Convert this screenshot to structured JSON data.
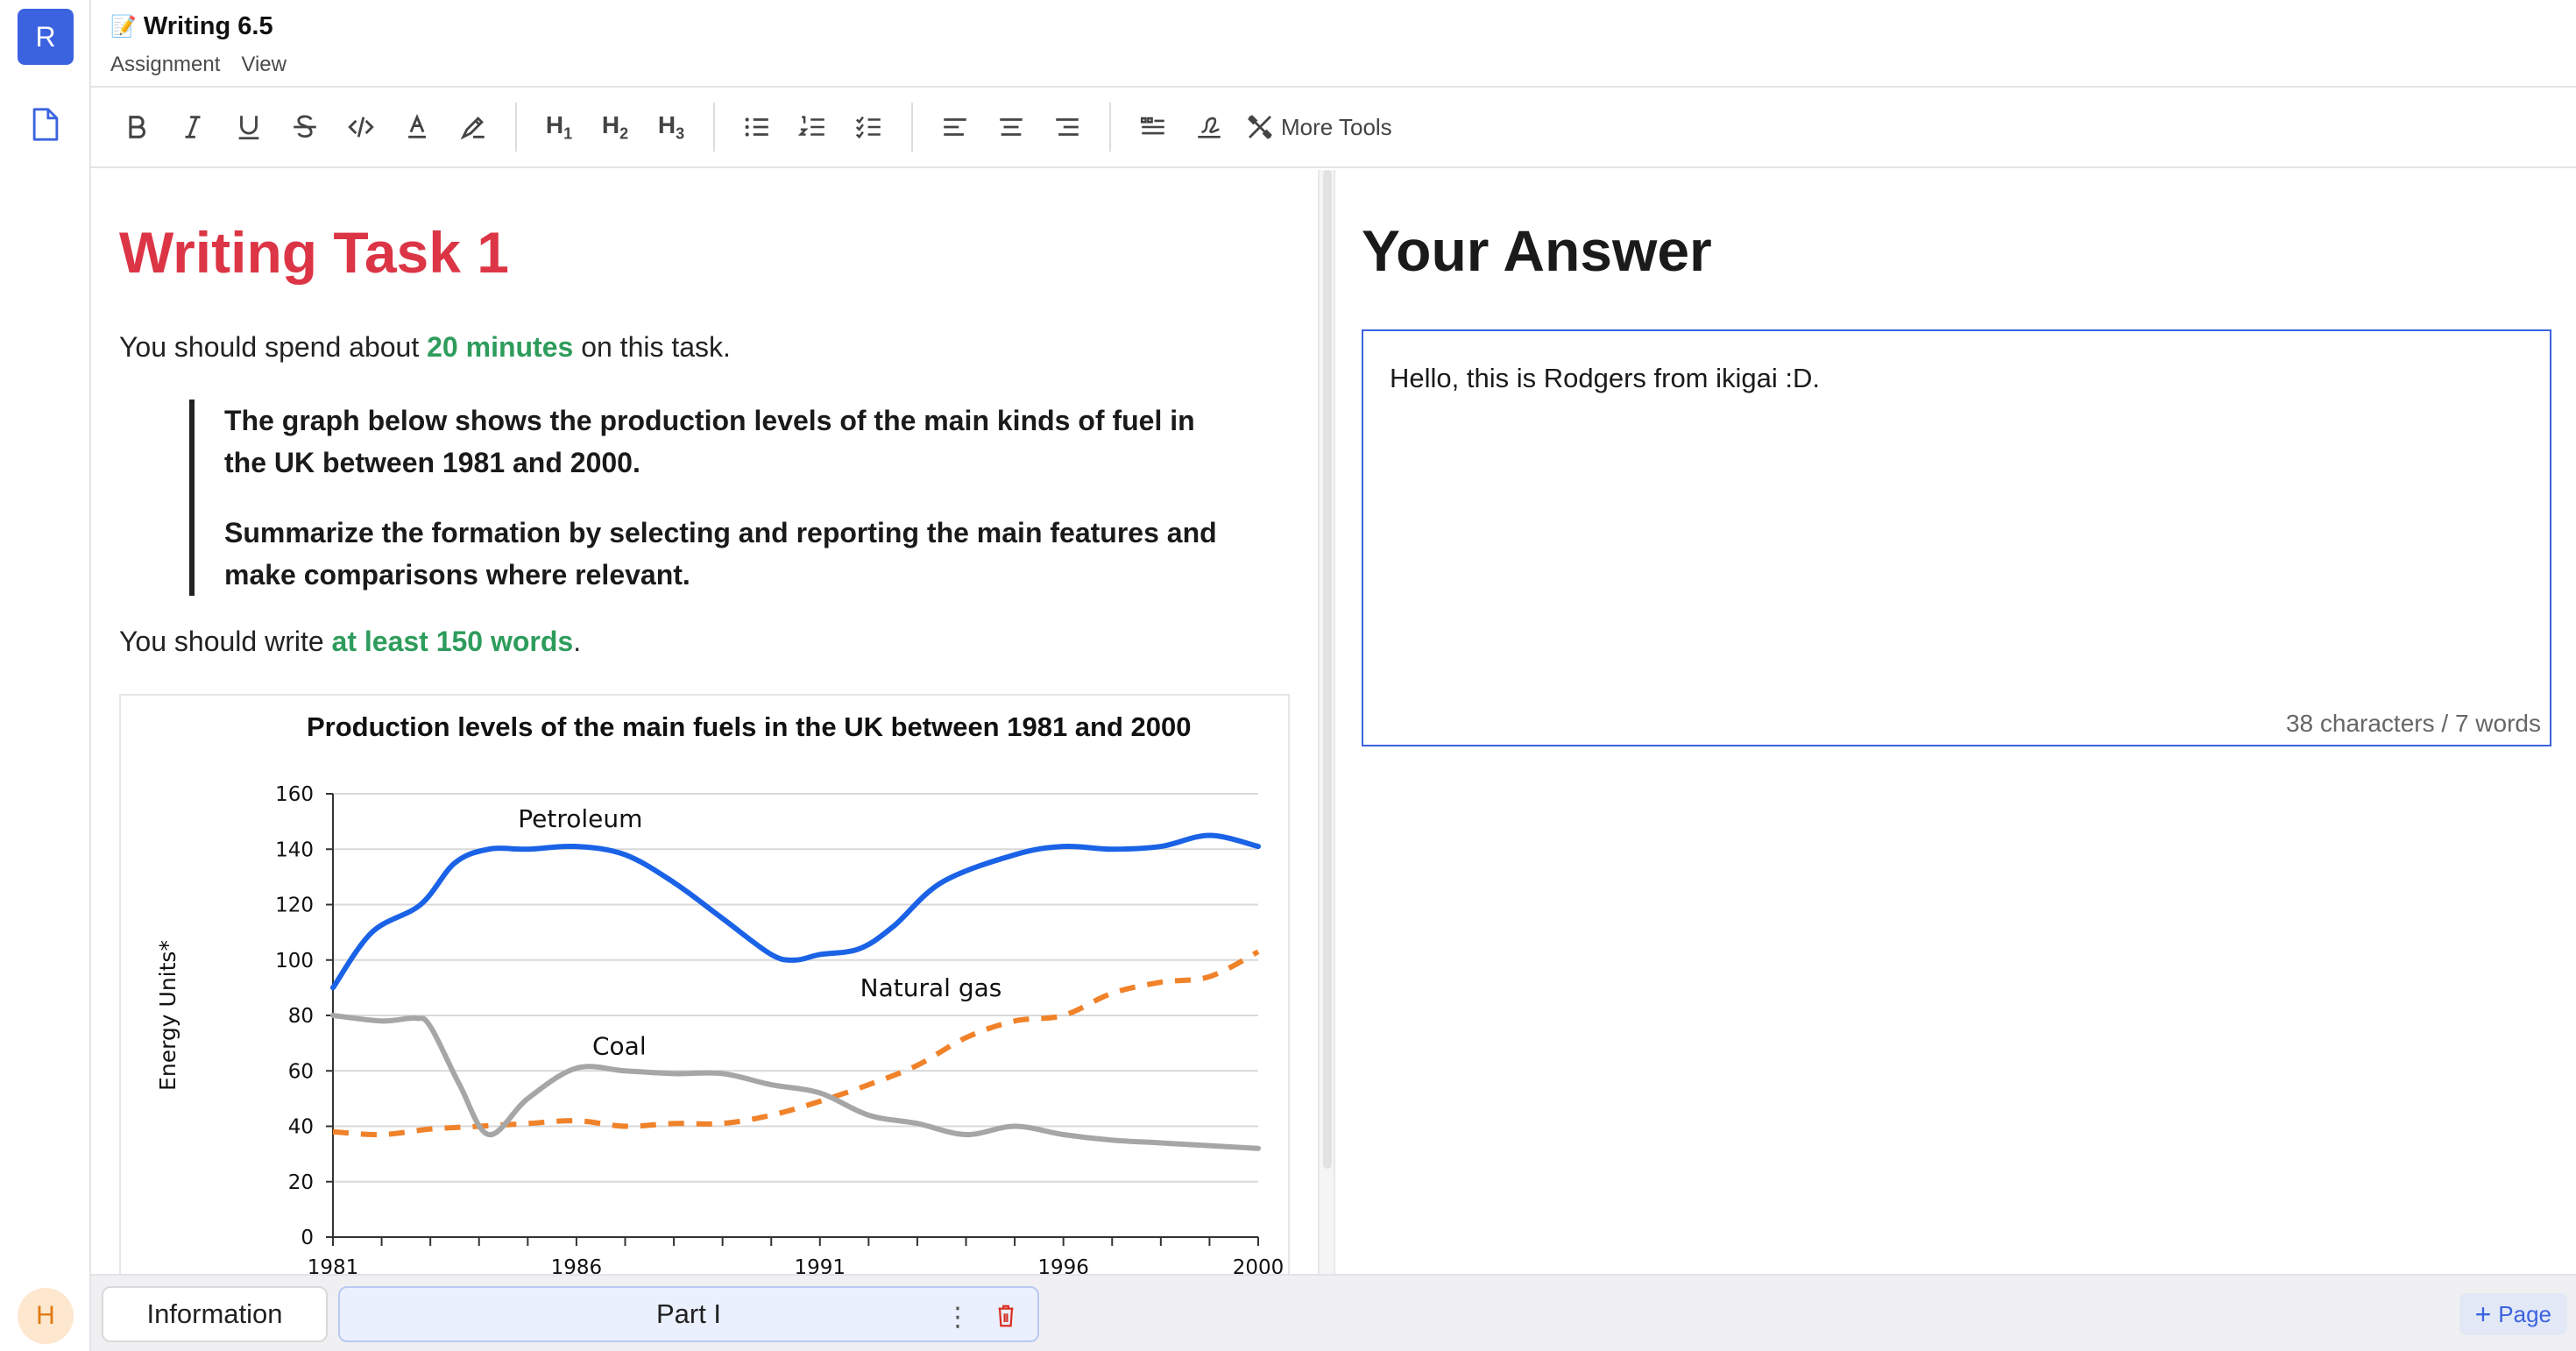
{
  "app": {
    "logo_letter": "R",
    "user_initial": "H"
  },
  "header": {
    "title": "Writing 6.5",
    "menus": [
      "Assignment",
      "View"
    ]
  },
  "toolbar": {
    "headings": [
      {
        "h": "H",
        "n": "1"
      },
      {
        "h": "H",
        "n": "2"
      },
      {
        "h": "H",
        "n": "3"
      }
    ],
    "more_tools_label": "More Tools"
  },
  "task": {
    "title": "Writing Task 1",
    "time_pre": "You should spend about ",
    "time_value": "20 minutes",
    "time_post": " on this task.",
    "prompt_1": "The graph below shows the production levels of the main kinds of fuel in the UK between 1981 and 2000.",
    "prompt_2": "Summarize the formation by selecting and reporting the main features and make comparisons where relevant.",
    "words_pre": "You should write ",
    "words_value": "at least 150 words",
    "words_post": "."
  },
  "answer": {
    "title": "Your Answer",
    "text": "Hello, this is Rodgers from ikigai :D.",
    "count": "38 characters / 7 words"
  },
  "bottom": {
    "tabs": [
      "Information",
      "Part I"
    ],
    "add_page_label": "Page"
  },
  "colors": {
    "accent": "#3b63e0",
    "task_title": "#dc3545",
    "highlight": "#2e9c5c",
    "petroleum": "#1a62e6",
    "natural_gas": "#f0822a",
    "coal": "#a6a6a6"
  },
  "chart_data": {
    "type": "line",
    "title": "Production levels of the main fuels in the UK between 1981 and 2000",
    "xlabel": "",
    "ylabel": "Energy Units*",
    "xlim": [
      1981,
      2000
    ],
    "ylim": [
      0,
      160
    ],
    "x_ticks": [
      1981,
      1986,
      1991,
      1996,
      2000
    ],
    "y_ticks": [
      0,
      20,
      40,
      60,
      80,
      100,
      120,
      140,
      160
    ],
    "grid": true,
    "series": [
      {
        "name": "Petroleum",
        "style": "solid",
        "x": [
          1981,
          1981.8,
          1982.8,
          1983.5,
          1984.2,
          1985,
          1986,
          1987,
          1988,
          1989,
          1990,
          1990.5,
          1991,
          1991.8,
          1992.5,
          1993.5,
          1995,
          1996,
          1997,
          1998,
          1999,
          2000
        ],
        "y": [
          90,
          110,
          120,
          135,
          140,
          140,
          141,
          138,
          128,
          115,
          102,
          100,
          102,
          104,
          112,
          128,
          138,
          141,
          140,
          141,
          145,
          141
        ]
      },
      {
        "name": "Natural gas",
        "style": "dashed",
        "x": [
          1981,
          1982,
          1983,
          1984,
          1985,
          1986,
          1987,
          1988,
          1989,
          1990,
          1991,
          1992,
          1993,
          1994,
          1995,
          1996,
          1997,
          1998,
          1999,
          2000
        ],
        "y": [
          38,
          37,
          39,
          40,
          41,
          42,
          40,
          41,
          41,
          44,
          49,
          55,
          62,
          72,
          78,
          80,
          88,
          92,
          94,
          103
        ]
      },
      {
        "name": "Coal",
        "style": "solid",
        "x": [
          1981,
          1982,
          1982.7,
          1983,
          1983.6,
          1984.2,
          1985,
          1986,
          1987,
          1988,
          1989,
          1990,
          1991,
          1992,
          1993,
          1994,
          1995,
          1996,
          1997,
          1998,
          1999,
          2000
        ],
        "y": [
          80,
          78,
          79,
          76,
          55,
          37,
          50,
          61,
          60,
          59,
          59,
          55,
          52,
          44,
          41,
          37,
          40,
          37,
          35,
          34,
          33,
          32
        ]
      }
    ]
  }
}
